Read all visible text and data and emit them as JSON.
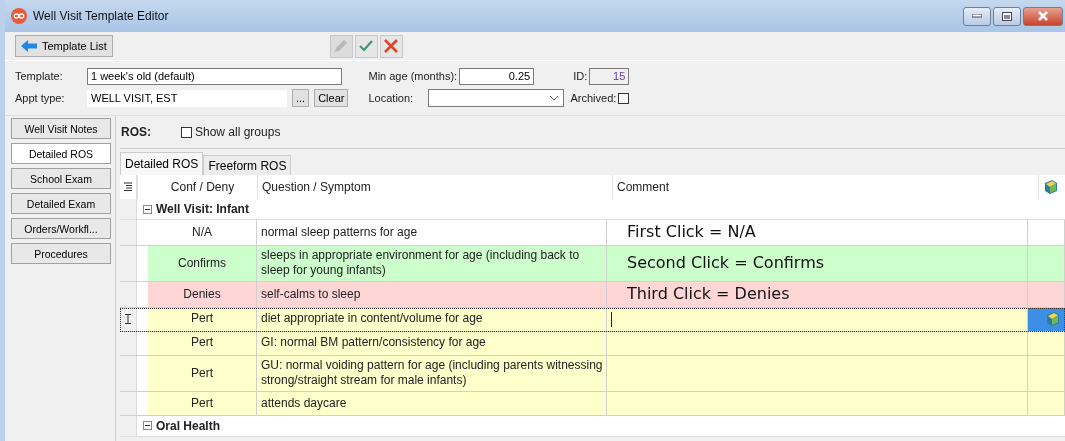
{
  "window": {
    "title": "Well Visit Template Editor"
  },
  "toolbar": {
    "back_button": "Template List",
    "actions": [
      {
        "kind": "edit",
        "disabled": true
      },
      {
        "kind": "save",
        "disabled": false
      },
      {
        "kind": "cancel",
        "disabled": false
      }
    ]
  },
  "form": {
    "template_label": "Template:",
    "template": "1 week's old (default)",
    "min_age_label": "Min age (months):",
    "min_age": "0.25",
    "id_label": "ID:",
    "id": "15",
    "appt_type_label": "Appt type:",
    "appt_type": "WELL VISIT, EST",
    "browse_button": "...",
    "clear_button": "Clear",
    "location_label": "Location:",
    "archived_label": "Archived:",
    "archived": false
  },
  "sidebar": {
    "items": [
      {
        "label": "Well Visit Notes",
        "selected": false
      },
      {
        "label": "Detailed ROS",
        "selected": true
      },
      {
        "label": "School Exam",
        "selected": false
      },
      {
        "label": "Detailed Exam",
        "selected": false
      },
      {
        "label": "Orders/Workfl...",
        "selected": false
      },
      {
        "label": "Procedures",
        "selected": false
      }
    ]
  },
  "ros": {
    "label": "ROS:",
    "show_all_groups": {
      "label": "Show all groups",
      "checked": false
    }
  },
  "tabs": [
    {
      "label": "Detailed ROS",
      "selected": true
    },
    {
      "label": "Freeform ROS",
      "selected": false
    }
  ],
  "table": {
    "columns": [
      "Conf / Deny",
      "Question / Symptom",
      "Comment"
    ],
    "groups": [
      {
        "title": "Well Visit: Infant",
        "expanded": true,
        "rows": [
          {
            "kind": "na",
            "status": "N/A",
            "question": "normal sleep patterns for age",
            "comment": "First Click = N/A",
            "selected": false
          },
          {
            "kind": "confirms",
            "status": "Confirms",
            "question": "sleeps in appropriate environment for age (including back to sleep for young infants)",
            "comment": "Second Click = Confirms",
            "selected": false
          },
          {
            "kind": "denies",
            "status": "Denies",
            "question": "self-calms to sleep",
            "comment": "Third Click = Denies",
            "selected": false
          },
          {
            "kind": "pert",
            "status": "Pert",
            "question": "diet appropriate in content/volume for age",
            "selected": true
          },
          {
            "kind": "pert",
            "status": "Pert",
            "question": "GI: normal BM pattern/consistency for age",
            "selected": false
          },
          {
            "kind": "pert",
            "status": "Pert",
            "question": "GU: normal voiding pattern for age (including parents witnessing strong/straight stream for male infants)",
            "selected": false
          },
          {
            "kind": "pert",
            "status": "Pert",
            "question": "attends daycare",
            "selected": false
          }
        ]
      },
      {
        "title": "Oral Health",
        "expanded": true
      }
    ]
  }
}
